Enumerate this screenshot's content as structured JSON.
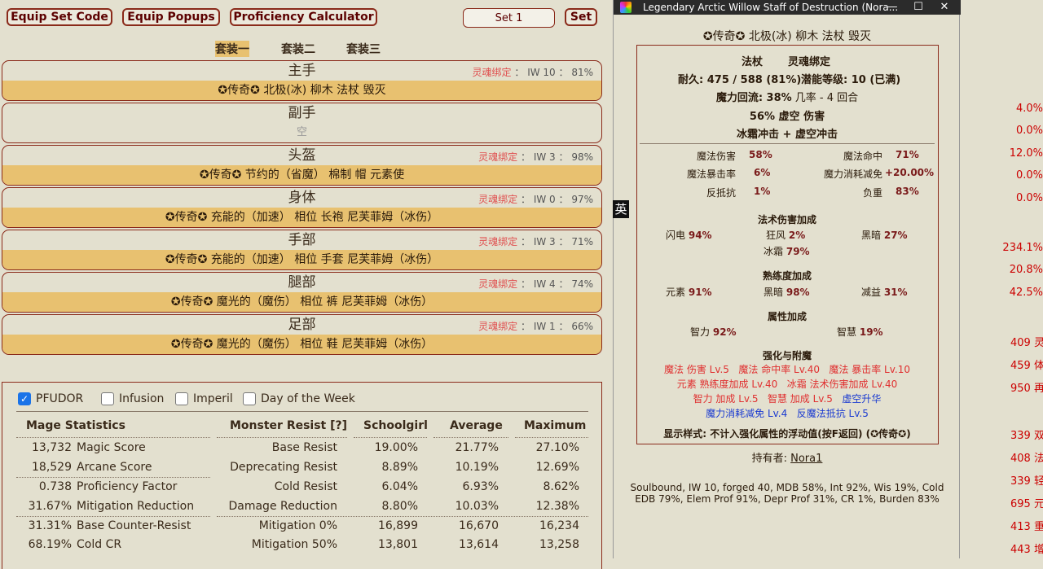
{
  "toolbar": {
    "equip_set_code": "Equip Set Code",
    "equip_popups": "Equip Popups",
    "proficiency_calculator": "Proficiency Calculator",
    "set_value": "Set 1",
    "set_button": "Set"
  },
  "set_tabs": [
    "套装一",
    "套装二",
    "套装三"
  ],
  "slots": [
    {
      "name": "主手",
      "soulbound": "灵魂绑定",
      "iw": "IW 10",
      "pct": "81%",
      "item": "✪传奇✪ 北极(冰) 柳木 法杖 毁灭"
    },
    {
      "name": "副手",
      "empty": "空"
    },
    {
      "name": "头盔",
      "soulbound": "灵魂绑定",
      "iw": "IW 3",
      "pct": "98%",
      "item": "✪传奇✪ 节约的（省魔） 棉制 帽 元素使"
    },
    {
      "name": "身体",
      "soulbound": "灵魂绑定",
      "iw": "IW 0",
      "pct": "97%",
      "item": "✪传奇✪ 充能的（加速） 相位 长袍 尼芙菲姆（冰伤）"
    },
    {
      "name": "手部",
      "soulbound": "灵魂绑定",
      "iw": "IW 3",
      "pct": "71%",
      "item": "✪传奇✪ 充能的（加速） 相位 手套 尼芙菲姆（冰伤）"
    },
    {
      "name": "腿部",
      "soulbound": "灵魂绑定",
      "iw": "IW 4",
      "pct": "74%",
      "item": "✪传奇✪ 魔光的（魔伤） 相位 裤 尼芙菲姆（冰伤）"
    },
    {
      "name": "足部",
      "soulbound": "灵魂绑定",
      "iw": "IW 1",
      "pct": "66%",
      "item": "✪传奇✪ 魔光的（魔伤） 相位 鞋 尼芙菲姆（冰伤）"
    }
  ],
  "options": {
    "pfudor": "PFUDOR",
    "infusion": "Infusion",
    "imperil": "Imperil",
    "day_of_week": "Day of the Week"
  },
  "stats": {
    "headers": [
      "Mage Statistics",
      "Monster Resist [?]",
      "Schoolgirl",
      "Average",
      "Maximum"
    ],
    "rows": [
      {
        "v": "13,732",
        "label": "Magic Score",
        "resist": "Base Resist",
        "s": "19.00%",
        "a": "21.77%",
        "m": "27.10%"
      },
      {
        "v": "18,529",
        "label": "Arcane Score",
        "resist": "Deprecating Resist",
        "s": "8.89%",
        "a": "10.19%",
        "m": "12.69%"
      },
      {
        "v": "0.738",
        "label": "Proficiency Factor",
        "resist": "Cold Resist",
        "s": "6.04%",
        "a": "6.93%",
        "m": "8.62%"
      },
      {
        "v": "31.67%",
        "label": "Mitigation Reduction",
        "resist": "Damage Reduction",
        "s": "8.80%",
        "a": "10.03%",
        "m": "12.38%"
      },
      {
        "v": "31.31%",
        "label": "Base Counter-Resist",
        "resist": "Mitigation 0%",
        "s": "16,899",
        "a": "16,670",
        "m": "16,234"
      },
      {
        "v": "68.19%",
        "label": "Cold CR",
        "resist": "Mitigation 50%",
        "s": "13,801",
        "a": "13,614",
        "m": "13,258"
      }
    ]
  },
  "ime_char": "英",
  "popup": {
    "title": "Legendary Arctic Willow Staff of Destruction (Nora...",
    "min": "—",
    "max": "☐",
    "close": "✕",
    "item_name": "✪传奇✪ 北极(冰) 柳木 法杖 毁灭",
    "type": "法杖",
    "soulbound": "灵魂绑定",
    "durability": "耐久: 475 / 588 (81%)",
    "potency": "潜能等级: 10 (已满)",
    "mana_flow_a": "魔力回流: 38%",
    "mana_flow_b": " 几率 - 4 回合",
    "void_dmg": "56% 虚空 伤害",
    "strikes": "冰霜冲击 + 虚空冲击",
    "stats": [
      {
        "l": "魔法伤害",
        "v": "58%",
        "l2": "魔法命中",
        "v2": "71%"
      },
      {
        "l": "魔法暴击率",
        "v": "6%",
        "l2": "魔力消耗减免",
        "v2": "+20.00%"
      },
      {
        "l": "反抵抗",
        "v": "1%",
        "l2": "负重",
        "v2": "83%"
      }
    ],
    "spell_dmg_title": "法术伤害加成",
    "spell_dmg": [
      {
        "l": "闪电",
        "v": "94%"
      },
      {
        "l": "狂风",
        "v": "2%"
      },
      {
        "l": "黑暗",
        "v": "27%"
      },
      {
        "l": "冰霜",
        "v": "79%"
      }
    ],
    "prof_title": "熟练度加成",
    "prof": [
      {
        "l": "元素",
        "v": "91%"
      },
      {
        "l": "黑暗",
        "v": "98%"
      },
      {
        "l": "减益",
        "v": "31%"
      }
    ],
    "attr_title": "属性加成",
    "attr": [
      {
        "l": "智力",
        "v": "92%"
      },
      {
        "l": "智慧",
        "v": "19%"
      }
    ],
    "upg_title": "强化与附魔",
    "upg_line1": [
      "魔法 伤害 Lv.5",
      "魔法 命中率 Lv.40",
      "魔法 暴击率 Lv.10"
    ],
    "upg_line2": [
      "元素 熟练度加成 Lv.40",
      "冰霜 法术伤害加成 Lv.40"
    ],
    "upg_line3a": [
      "智力 加成 Lv.5",
      "智慧 加成 Lv.5"
    ],
    "upg_line3b": "虚空升华",
    "upg_line4": [
      "魔力消耗减免 Lv.4",
      "反魔法抵抗 Lv.5"
    ],
    "display_mode": "显示样式: 不计入强化属性的浮动值(按F返回) (✪传奇✪)",
    "holder_label": "持有者: ",
    "holder": "Nora1",
    "summary": "Soulbound, IW 10, forged 40, MDB 58%, Int 92%, Wis 19%, Cold EDB 79%, Elem Prof 91%, Depr Prof 31%, CR 1%, Burden 83%"
  },
  "right_edge": {
    "pct": [
      "4.0%",
      "0.0%",
      "12.0%",
      "0.0%",
      "0.0%",
      "234.1%",
      "20.8%",
      "42.5%"
    ],
    "rows": [
      {
        "n": "409",
        "c": "灵"
      },
      {
        "n": "459",
        "c": "体"
      },
      {
        "n": "950",
        "c": "再"
      },
      {
        "n": "339",
        "c": "双"
      },
      {
        "n": "408",
        "c": "法"
      },
      {
        "n": "339",
        "c": "轻"
      },
      {
        "n": "695",
        "c": "元"
      },
      {
        "n": "413",
        "c": "重"
      },
      {
        "n": "443",
        "c": "增"
      }
    ]
  }
}
